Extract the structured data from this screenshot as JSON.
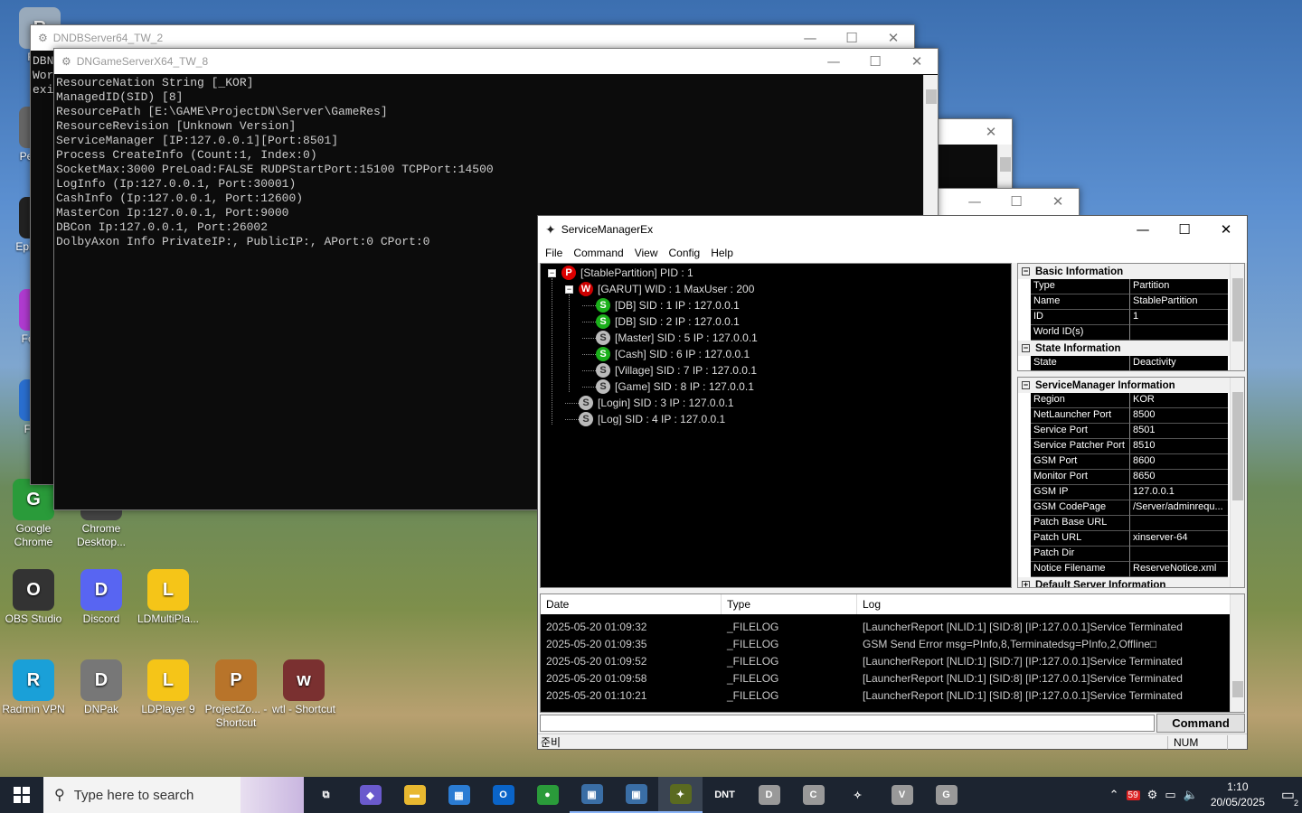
{
  "desktop": {
    "icons": [
      {
        "label": "Recy",
        "color": "#9ab"
      },
      {
        "label": "Pe tenta",
        "color": "#666"
      },
      {
        "label": "Epic Laun",
        "color": "#222"
      },
      {
        "label": "Foxi Ed",
        "color": "#b03bd0"
      },
      {
        "label": "F Dow",
        "color": "#2a6fd0"
      },
      {
        "label": "Google Chrome",
        "color": "#2a9b3a"
      },
      {
        "label": "Chrome Desktop...",
        "color": "#444"
      },
      {
        "label": "OBS Studio",
        "color": "#333"
      },
      {
        "label": "Discord",
        "color": "#5865f2"
      },
      {
        "label": "LDMultiPla...",
        "color": "#f5c518"
      },
      {
        "label": "Radmin VPN",
        "color": "#1aa0d8"
      },
      {
        "label": "DNPak",
        "color": "#777"
      },
      {
        "label": "LDPlayer 9",
        "color": "#f5c518"
      },
      {
        "label": "ProjectZo... - Shortcut",
        "color": "#b8742a"
      },
      {
        "label": "wtl - Shortcut",
        "color": "#7a3030"
      }
    ]
  },
  "win_db": {
    "title": "DNDBServer64_TW_2",
    "side_text": [
      "DBN",
      "Wor",
      "exi"
    ]
  },
  "win_game": {
    "title": "DNGameServerX64_TW_8",
    "console_lines": [
      "ResourceNation String [_KOR]",
      "ManagedID(SID) [8]",
      "ResourcePath [E:\\GAME\\ProjectDN\\Server\\GameRes]",
      "ResourceRevision [Unknown Version]",
      "ServiceManager [IP:127.0.0.1][Port:8501]",
      "Process CreateInfo (Count:1, Index:0)",
      "SocketMax:3000 PreLoad:FALSE RUDPStartPort:15100 TCPPort:14500",
      "LogInfo (Ip:127.0.0.1, Port:30001)",
      "CashInfo (Ip:127.0.0.1, Port:12600)",
      "MasterCon Ip:127.0.0.1, Port:9000",
      "DBCon Ip:127.0.0.1, Port:26002",
      "DolbyAxon Info PrivateIP:, PublicIP:, APort:0 CPort:0"
    ]
  },
  "smx": {
    "title": "ServiceManagerEx",
    "menu": [
      "File",
      "Command",
      "View",
      "Config",
      "Help"
    ],
    "tree": [
      {
        "badge": "P",
        "cls": "b-p",
        "text": "[StablePartition] PID : 1",
        "level": 0,
        "expander": "−"
      },
      {
        "badge": "W",
        "cls": "b-w",
        "text": "[GARUT] WID : 1 MaxUser : 200",
        "level": 1,
        "expander": "−"
      },
      {
        "badge": "S",
        "cls": "b-s",
        "text": "[DB] SID : 1 IP : 127.0.0.1",
        "level": 2
      },
      {
        "badge": "S",
        "cls": "b-s",
        "text": "[DB] SID : 2 IP : 127.0.0.1",
        "level": 2
      },
      {
        "badge": "S",
        "cls": "b-g",
        "text": "[Master] SID : 5 IP : 127.0.0.1",
        "level": 2
      },
      {
        "badge": "S",
        "cls": "b-s",
        "text": "[Cash] SID : 6 IP : 127.0.0.1",
        "level": 2
      },
      {
        "badge": "S",
        "cls": "b-g",
        "text": "[Village] SID : 7 IP : 127.0.0.1",
        "level": 2
      },
      {
        "badge": "S",
        "cls": "b-g",
        "text": "[Game] SID : 8 IP : 127.0.0.1",
        "level": 2
      },
      {
        "badge": "S",
        "cls": "b-g",
        "text": "[Login] SID : 3 IP : 127.0.0.1",
        "level": 1
      },
      {
        "badge": "S",
        "cls": "b-g",
        "text": "[Log] SID : 4 IP : 127.0.0.1",
        "level": 1
      }
    ],
    "basic_pg": {
      "cat1": "Basic Information",
      "rows1": [
        [
          "Type",
          "Partition"
        ],
        [
          "Name",
          "StablePartition"
        ],
        [
          "ID",
          "1"
        ],
        [
          "World ID(s)",
          ""
        ]
      ],
      "cat2": "State Information",
      "rows2": [
        [
          "State",
          "Deactivity"
        ]
      ]
    },
    "sm_pg": {
      "cat1": "ServiceManager Information",
      "rows": [
        [
          "Region",
          "KOR"
        ],
        [
          "NetLauncher Port",
          "8500"
        ],
        [
          "Service Port",
          "8501"
        ],
        [
          "Service Patcher Port",
          "8510"
        ],
        [
          "GSM Port",
          "8600"
        ],
        [
          "Monitor Port",
          "8650"
        ],
        [
          "GSM IP",
          "127.0.0.1"
        ],
        [
          "GSM CodePage",
          "/Server/adminrequ..."
        ],
        [
          "Patch Base URL",
          ""
        ],
        [
          "Patch URL",
          "xinserver-64"
        ],
        [
          "Patch Dir",
          ""
        ],
        [
          "Notice Filename",
          "ReserveNotice.xml"
        ]
      ],
      "cat2": "Default Server Information"
    },
    "log_headers": [
      "Date",
      "Type",
      "Log"
    ],
    "log_rows": [
      [
        "2025-05-20 01:09:32",
        "_FILELOG",
        "[LauncherReport [NLID:1] [SID:8] [IP:127.0.0.1]Service Terminated"
      ],
      [
        "2025-05-20 01:09:35",
        "_FILELOG",
        "GSM Send Error msg=PInfo,8,Terminatedsg=PInfo,2,Offline□"
      ],
      [
        "2025-05-20 01:09:52",
        "_FILELOG",
        "[LauncherReport [NLID:1] [SID:7] [IP:127.0.0.1]Service Terminated"
      ],
      [
        "2025-05-20 01:09:58",
        "_FILELOG",
        "[LauncherReport [NLID:1] [SID:8] [IP:127.0.0.1]Service Terminated"
      ],
      [
        "2025-05-20 01:10:21",
        "_FILELOG",
        "[LauncherReport [NLID:1] [SID:8] [IP:127.0.0.1]Service Terminated"
      ]
    ],
    "command_value": "",
    "command_label": "Command",
    "status_left": "준비",
    "status_num": "NUM"
  },
  "taskbar": {
    "search_placeholder": "Type here to search",
    "apps": [
      {
        "name": "task-view-icon",
        "glyph": "⧉",
        "bg": "transparent"
      },
      {
        "name": "copilot-icon",
        "glyph": "◆",
        "bg": "#6a5acd"
      },
      {
        "name": "file-explorer-icon",
        "glyph": "▬",
        "bg": "#e8b830"
      },
      {
        "name": "store-icon",
        "glyph": "▦",
        "bg": "#2b7cd3"
      },
      {
        "name": "outlook-icon",
        "glyph": "O",
        "bg": "#0a64c8"
      },
      {
        "name": "chrome-icon",
        "glyph": "●",
        "bg": "#2a9b3a"
      },
      {
        "name": "console-app-icon",
        "glyph": "▣",
        "bg": "#3a6ea5"
      },
      {
        "name": "console-app-2-icon",
        "glyph": "▣",
        "bg": "#3a6ea5"
      },
      {
        "name": "servicemanager-icon",
        "glyph": "✦",
        "bg": "#5a6a20"
      },
      {
        "name": "dnt-icon",
        "glyph": "DNT",
        "bg": "transparent"
      },
      {
        "name": "d-app-icon",
        "glyph": "D",
        "bg": "#999"
      },
      {
        "name": "c-app-icon",
        "glyph": "C",
        "bg": "#999"
      },
      {
        "name": "dnpak-icon",
        "glyph": "✧",
        "bg": "transparent"
      },
      {
        "name": "v-app-icon",
        "glyph": "V",
        "bg": "#999"
      },
      {
        "name": "g-app-icon",
        "glyph": "G",
        "bg": "#999"
      }
    ],
    "tray_badge": "59",
    "time": "1:10",
    "date": "20/05/2025",
    "notif_count": "2"
  }
}
